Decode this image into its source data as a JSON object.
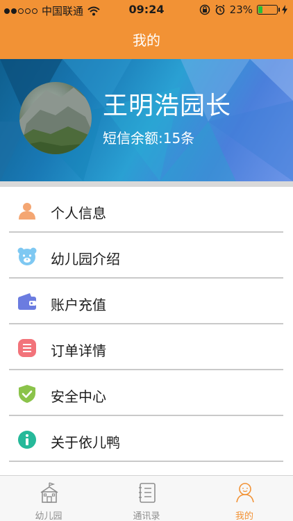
{
  "status_bar": {
    "carrier": "中国联通",
    "time": "09:24",
    "battery": "23%",
    "battery_level": 0.23,
    "signal_dots_filled": 2,
    "signal_dots_total": 5
  },
  "nav": {
    "title": "我的"
  },
  "profile": {
    "name": "王明浩园长",
    "sms_balance": "短信余额:15条"
  },
  "menu": {
    "items": [
      {
        "label": "个人信息",
        "icon": "person-icon",
        "color": "#f4a672"
      },
      {
        "label": "幼儿园介绍",
        "icon": "bear-icon",
        "color": "#7ec8f2"
      },
      {
        "label": "账户充值",
        "icon": "wallet-icon",
        "color": "#6b7ce0"
      },
      {
        "label": "订单详情",
        "icon": "list-icon",
        "color": "#f2737a"
      },
      {
        "label": "安全中心",
        "icon": "shield-icon",
        "color": "#8bc34a"
      },
      {
        "label": "关于依儿鸭",
        "icon": "info-icon",
        "color": "#26b99a"
      }
    ]
  },
  "tabbar": {
    "tabs": [
      {
        "label": "幼儿园",
        "icon": "school-icon",
        "active": false
      },
      {
        "label": "通讯录",
        "icon": "contacts-icon",
        "active": false
      },
      {
        "label": "我的",
        "icon": "profile-icon",
        "active": true
      }
    ]
  },
  "colors": {
    "accent": "#f29235",
    "tab_inactive": "#8e8e8e",
    "battery_fill": "#25c03a"
  }
}
